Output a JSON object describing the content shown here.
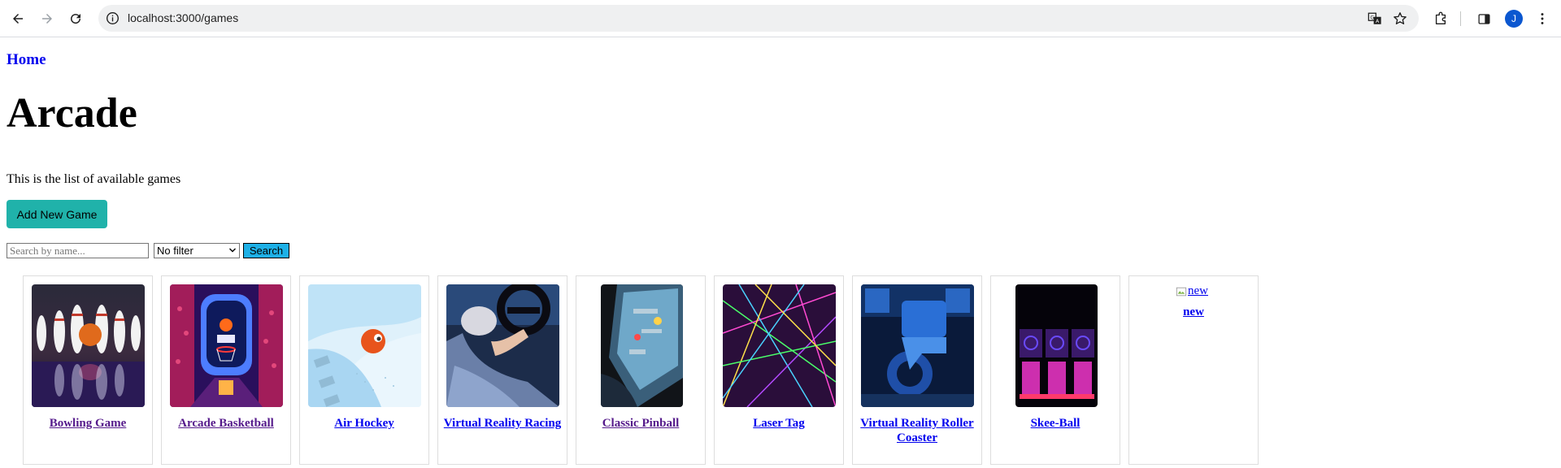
{
  "browser": {
    "url": "localhost:3000/games",
    "profile_initial": "J"
  },
  "nav": {
    "home_label": "Home"
  },
  "page": {
    "title": "Arcade",
    "description": "This is the list of available games",
    "add_button_label": "Add New Game",
    "search": {
      "placeholder": "Search by name...",
      "value": "",
      "filter_selected": "No filter",
      "button_label": "Search"
    }
  },
  "games": [
    {
      "name": "Bowling Game",
      "image": "bowling",
      "visited": true
    },
    {
      "name": "Arcade Basketball",
      "image": "basketball",
      "visited": true
    },
    {
      "name": "Air Hockey",
      "image": "air-hockey",
      "visited": false
    },
    {
      "name": "Virtual Reality Racing",
      "image": "vr-racing",
      "visited": false
    },
    {
      "name": "Classic Pinball",
      "image": "pinball",
      "visited": true
    },
    {
      "name": "Laser Tag",
      "image": "laser-tag",
      "visited": false
    },
    {
      "name": "Virtual Reality Roller Coaster",
      "image": "vr-coaster",
      "visited": false
    },
    {
      "name": "Skee-Ball",
      "image": "skee-ball",
      "visited": false
    },
    {
      "name": "new",
      "image": "broken",
      "alt": "new",
      "visited": false
    }
  ],
  "colors": {
    "link": "#0000ee",
    "visited_link": "#551a8b",
    "add_button": "#20b2aa",
    "search_button": "#1eb0e6"
  }
}
